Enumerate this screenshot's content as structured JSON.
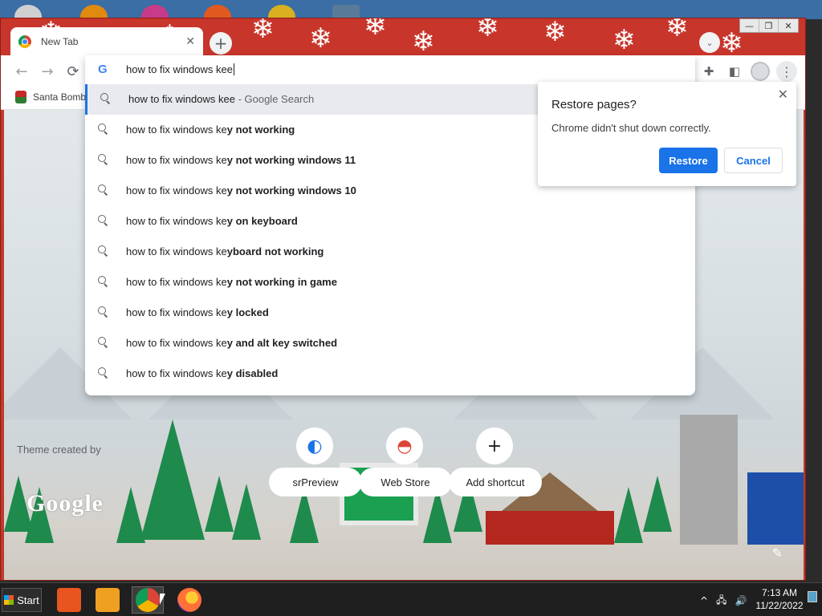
{
  "browser": {
    "tab": {
      "title": "New Tab",
      "close_glyph": "✕",
      "icon": "chrome-icon"
    },
    "newtab_glyph": "+",
    "tab_search_glyph": "⌄",
    "window_controls": {
      "minimize": "—",
      "restore": "❐",
      "close": "✕"
    },
    "toolbar": {
      "back_glyph": "←",
      "forward_glyph": "→",
      "reload_glyph": "⟳",
      "extensions_glyph": "✚",
      "side_panel_glyph": "◧",
      "menu_glyph": "⋮"
    },
    "bookmarks": [
      {
        "label": "Santa Bomb",
        "icon": "santa-icon"
      }
    ]
  },
  "omnibox": {
    "g_glyph": "G",
    "input_value": "how to fix windows kee",
    "suggestions": [
      {
        "typed": "how to fix windows kee",
        "completion": "",
        "suffix": " - Google Search",
        "selected": true
      },
      {
        "typed": "how to fix windows ke",
        "completion": "y not working",
        "suffix": ""
      },
      {
        "typed": "how to fix windows ke",
        "completion": "y not working windows 11",
        "suffix": ""
      },
      {
        "typed": "how to fix windows ke",
        "completion": "y not working windows 10",
        "suffix": ""
      },
      {
        "typed": "how to fix windows ke",
        "completion": "y on keyboard",
        "suffix": ""
      },
      {
        "typed": "how to fix windows ke",
        "completion": "yboard not working",
        "suffix": ""
      },
      {
        "typed": "how to fix windows ke",
        "completion": "y not working in game",
        "suffix": ""
      },
      {
        "typed": "how to fix windows ke",
        "completion": "y locked",
        "suffix": ""
      },
      {
        "typed": "how to fix windows ke",
        "completion": "y and alt key switched",
        "suffix": ""
      },
      {
        "typed": "how to fix windows ke",
        "completion": "y disabled",
        "suffix": ""
      }
    ]
  },
  "restore_dialog": {
    "title": "Restore pages?",
    "message": "Chrome didn't shut down correctly.",
    "restore_label": "Restore",
    "cancel_label": "Cancel",
    "close_glyph": "✕"
  },
  "ntp": {
    "theme_credit": "Theme created by",
    "logo_text": "Google",
    "shortcuts": [
      {
        "label": "srPreview",
        "icon": "srpreview-icon",
        "glyph": "◐"
      },
      {
        "label": "Web Store",
        "icon": "webstore-icon",
        "glyph": "◓"
      },
      {
        "label": "Add shortcut",
        "icon": "plus-icon",
        "glyph": "+"
      }
    ],
    "edit_glyph": "✎"
  },
  "taskbar": {
    "start_label": "Start",
    "apps": [
      {
        "name": "file-explorer",
        "color": "#e8551f"
      },
      {
        "name": "media-player",
        "color": "#f0a020"
      },
      {
        "name": "chrome",
        "color": "#4285f4",
        "active": true
      },
      {
        "name": "firefox",
        "color": "#ff7139"
      }
    ],
    "tray": {
      "chevron": "^",
      "network": "🖧",
      "volume": "🔊"
    },
    "clock": {
      "time": "7:13 AM",
      "date": "11/22/2022"
    }
  },
  "colors": {
    "theme_red": "#c8352b",
    "accent_blue": "#1a73e8",
    "tree_green": "#1e8a4c"
  }
}
